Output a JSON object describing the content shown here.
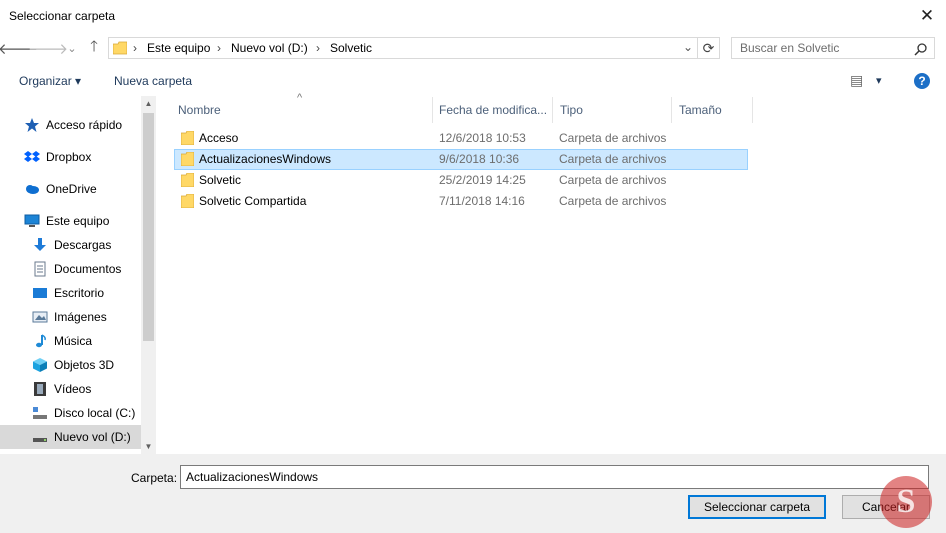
{
  "window": {
    "title": "Seleccionar carpeta",
    "close_glyph": "✕"
  },
  "nav": {
    "back": "🡐",
    "forward": "🡒",
    "recent": "⌄",
    "up": "🡑",
    "breadcrumb": [
      "Este equipo",
      "Nuevo vol (D:)",
      "Solvetic"
    ],
    "separator": "›",
    "dropdown": "⌄",
    "refresh": "⟳"
  },
  "search": {
    "placeholder": "Buscar en Solvetic",
    "icon": "search-icon"
  },
  "toolbar": {
    "organize": "Organizar ▾",
    "new_folder": "Nueva carpeta",
    "view_glyph": "▤",
    "view_arrow": "▾",
    "help": "?"
  },
  "sidebar": {
    "items": [
      {
        "label": "Acceso rápido",
        "icon": "star-icon",
        "color": "#1e5fb3"
      },
      {
        "label": "Dropbox",
        "icon": "dropbox-icon",
        "color": "#0061fe"
      },
      {
        "label": "OneDrive",
        "icon": "cloud-icon",
        "color": "#0f6fd1"
      },
      {
        "label": "Este equipo",
        "icon": "computer-icon",
        "color": "#1c84d6"
      },
      {
        "label": "Descargas",
        "icon": "download-icon",
        "color": "#1e7bd8"
      },
      {
        "label": "Documentos",
        "icon": "document-icon",
        "color": "#6a7a8c"
      },
      {
        "label": "Escritorio",
        "icon": "desktop-icon",
        "color": "#1a7bd6"
      },
      {
        "label": "Imágenes",
        "icon": "image-icon",
        "color": "#5a7a99"
      },
      {
        "label": "Música",
        "icon": "music-icon",
        "color": "#1e8ad6"
      },
      {
        "label": "Objetos 3D",
        "icon": "cube-icon",
        "color": "#1ca3e0"
      },
      {
        "label": "Vídeos",
        "icon": "video-icon",
        "color": "#3a3a3a"
      },
      {
        "label": "Disco local (C:)",
        "icon": "drive-icon",
        "color": "#4a8ad6"
      },
      {
        "label": "Nuevo vol (D:)",
        "icon": "drive-icon",
        "color": "#555555",
        "selected": true
      }
    ]
  },
  "columns": {
    "name": "Nombre",
    "date": "Fecha de modifica...",
    "type": "Tipo",
    "size": "Tamaño",
    "sort_glyph": "^"
  },
  "files": [
    {
      "name": "Acceso",
      "date": "12/6/2018 10:53",
      "type": "Carpeta de archivos",
      "selected": false
    },
    {
      "name": "ActualizacionesWindows",
      "date": "9/6/2018 10:36",
      "type": "Carpeta de archivos",
      "selected": true
    },
    {
      "name": "Solvetic",
      "date": "25/2/2019 14:25",
      "type": "Carpeta de archivos",
      "selected": false
    },
    {
      "name": "Solvetic Compartida",
      "date": "7/11/2018 14:16",
      "type": "Carpeta de archivos",
      "selected": false
    }
  ],
  "footer": {
    "folder_label": "Carpeta:",
    "folder_value": "ActualizacionesWindows",
    "select_button": "Seleccionar carpeta",
    "cancel_button": "Cancelar"
  },
  "colors": {
    "accent": "#0078d7",
    "selection": "#cce8ff",
    "folder": "#ffd866"
  }
}
